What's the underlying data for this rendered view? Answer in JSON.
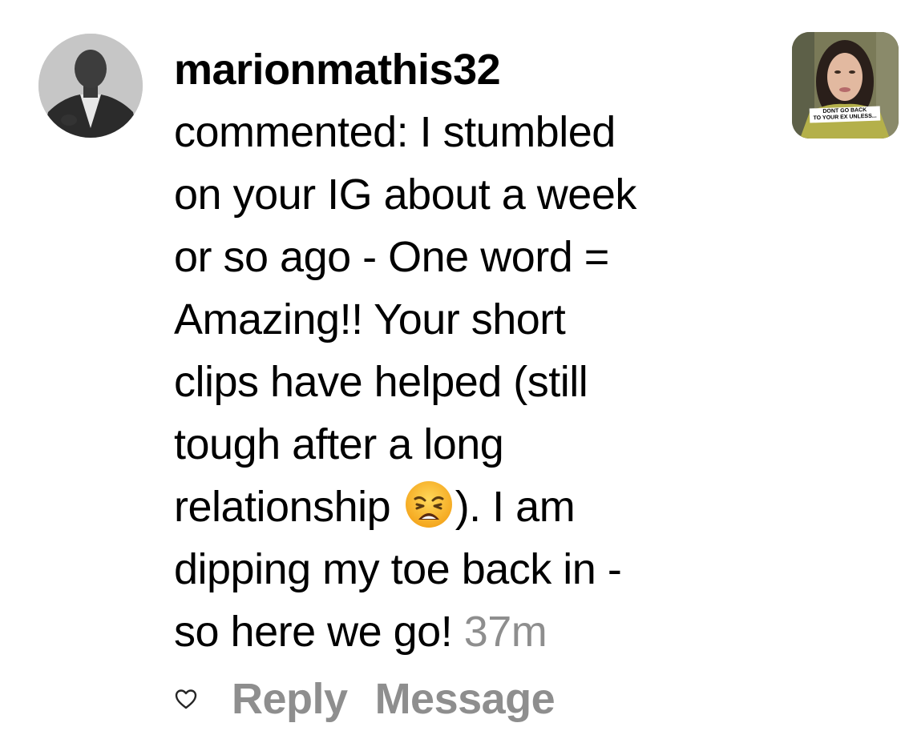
{
  "comment": {
    "username": "marionmathis32",
    "verb": "commented:",
    "text_lines": [
      "I stumbled",
      "on your IG about a week",
      "or so ago - One word =",
      "Amazing!! Your short",
      "clips have helped (still",
      "tough after a long",
      "relationship",
      "). I am",
      "dipping my toe back in -",
      "so here we go!"
    ],
    "emoji": "weary-face-emoji",
    "timestamp": "37m"
  },
  "actions": {
    "like_icon": "heart-icon",
    "reply_label": "Reply",
    "message_label": "Message"
  },
  "thumbnail": {
    "caption_line1": "DONT GO BACK",
    "caption_line2": "TO YOUR EX UNLESS..."
  },
  "colors": {
    "text": "#000000",
    "muted": "#8e8e8e",
    "background": "#ffffff"
  }
}
